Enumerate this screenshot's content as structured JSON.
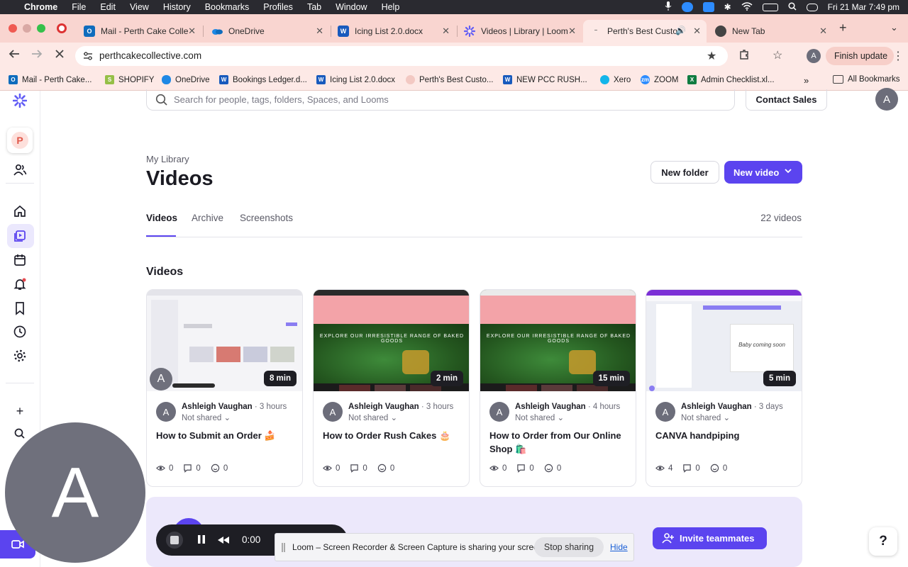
{
  "menubar": {
    "app": "Chrome",
    "items": [
      "File",
      "Edit",
      "View",
      "History",
      "Bookmarks",
      "Profiles",
      "Tab",
      "Window",
      "Help"
    ],
    "datetime": "Fri 21 Mar  7:49 pm"
  },
  "tabs": [
    {
      "title": "Mail - Perth Cake Colle",
      "icon": "outlook-icon",
      "color": "#0f6cbd"
    },
    {
      "title": "OneDrive",
      "icon": "onedrive-icon",
      "color": "#1e88e5"
    },
    {
      "title": "Icing List 2.0.docx",
      "icon": "word-icon",
      "color": "#185abd"
    },
    {
      "title": "Videos | Library | Loom",
      "icon": "loom-icon",
      "color": "#625df5"
    },
    {
      "title": "Perth's Best Custo",
      "icon": "loading-icon",
      "color": "#888888"
    },
    {
      "title": "New Tab",
      "icon": "chrome-icon",
      "color": "#444444"
    }
  ],
  "toolbar": {
    "url": "perthcakecollective.com",
    "finish_update": "Finish update",
    "profile_initial": "A"
  },
  "bookmarks": {
    "items": [
      "Mail - Perth Cake...",
      "SHOPIFY",
      "OneDrive",
      "Bookings Ledger.d...",
      "Icing List 2.0.docx",
      "Perth's Best Custo...",
      "NEW PCC RUSH...",
      "Xero",
      "ZOOM",
      "Admin Checklist.xl..."
    ],
    "all_bookmarks": "All Bookmarks"
  },
  "sidebar": {
    "workspace_initial": "P",
    "more_label": "+"
  },
  "header": {
    "search_placeholder": "Search for people, tags, folders, Spaces, and Looms",
    "contact_sales": "Contact Sales",
    "avatar_initial": "A"
  },
  "library": {
    "breadcrumb": "My Library",
    "title": "Videos",
    "new_folder": "New folder",
    "new_video": "New video",
    "tabs": [
      "Videos",
      "Archive",
      "Screenshots"
    ],
    "count": "22 videos",
    "section": "Videos"
  },
  "videos": [
    {
      "author": "Ashleigh Vaughan",
      "ago": "3 hours",
      "sharing": "Not shared",
      "title": "How to Submit an Order 🍰",
      "duration": "8 min",
      "views": "0",
      "comments": "0",
      "reactions": "0"
    },
    {
      "author": "Ashleigh Vaughan",
      "ago": "3 hours",
      "sharing": "Not shared",
      "title": "How to Order Rush Cakes 🎂",
      "duration": "2 min",
      "views": "0",
      "comments": "0",
      "reactions": "0"
    },
    {
      "author": "Ashleigh Vaughan",
      "ago": "4 hours",
      "sharing": "Not shared",
      "title": "How to Order from Our Online Shop 🛍️",
      "duration": "15 min",
      "views": "0",
      "comments": "0",
      "reactions": "0"
    },
    {
      "author": "Ashleigh Vaughan",
      "ago": "3 days",
      "sharing": "Not shared",
      "title": "CANVA handpiping",
      "duration": "5 min",
      "views": "4",
      "comments": "0",
      "reactions": "0"
    }
  ],
  "thumb_text": {
    "site_hero": "EXPLORE OUR IRRESISTIBLE RANGE OF BAKED GOODS",
    "canva": "Baby coming soon"
  },
  "invite": "Invite teammates",
  "help": "?",
  "loom_recorder": {
    "camera_initial": "A",
    "timer": "0:00",
    "share_message": "Loom – Screen Recorder & Screen Capture is sharing your screen.",
    "stop_sharing": "Stop sharing",
    "hide": "Hide"
  },
  "colors": {
    "accent": "#5b44ef",
    "tabstrip": "#f9d5d0"
  }
}
